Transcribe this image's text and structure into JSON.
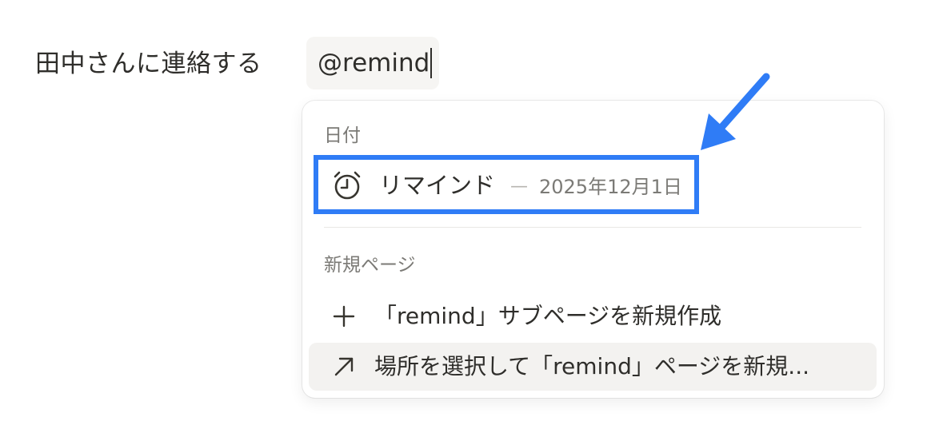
{
  "editor": {
    "line_text": "田中さんに連絡する",
    "mention_query": "@remind"
  },
  "menu": {
    "date_section": {
      "label": "日付",
      "items": [
        {
          "icon": "alarm-clock-icon",
          "label": "リマインド",
          "separator": "—",
          "date": "2025年12月1日",
          "highlighted": true
        }
      ]
    },
    "new_page_section": {
      "label": "新規ページ",
      "items": [
        {
          "icon": "plus-icon",
          "label": "「remind」サブページを新規作成"
        },
        {
          "icon": "arrow-up-right-icon",
          "label": "場所を選択して「remind」ページを新規..."
        }
      ]
    }
  },
  "annotation": {
    "icon": "arrow-pointer-icon",
    "color": "#2f7cf6"
  }
}
